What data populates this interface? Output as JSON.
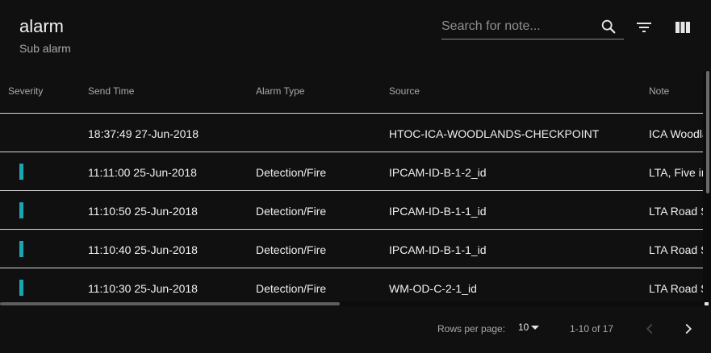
{
  "header": {
    "title": "alarm",
    "subtitle": "Sub alarm",
    "search_placeholder": "Search for note..."
  },
  "icons": {
    "search": "search-icon",
    "filter": "filter-list-icon",
    "columns": "view-column-icon",
    "dropdown": "caret-down-icon",
    "prev": "chevron-left-icon",
    "next": "chevron-right-icon"
  },
  "colors": {
    "severity_indicator": "#1aa5b3",
    "background": "#101010"
  },
  "table": {
    "columns": [
      "Severity",
      "Send Time",
      "Alarm Type",
      "Source",
      "Note"
    ],
    "rows": [
      {
        "severity": "",
        "send_time": "18:37:49 27-Jun-2018",
        "alarm_type": "",
        "source": "HTOC-ICA-WOODLANDS-CHECKPOINT",
        "note": "ICA Woodla"
      },
      {
        "severity": "teal",
        "send_time": "11:11:00 25-Jun-2018",
        "alarm_type": "Detection/Fire",
        "source": "IPCAM-ID-B-1-2_id",
        "note": "LTA, Five in"
      },
      {
        "severity": "teal",
        "send_time": "11:10:50 25-Jun-2018",
        "alarm_type": "Detection/Fire",
        "source": "IPCAM-ID-B-1-1_id",
        "note": "LTA Road S"
      },
      {
        "severity": "teal",
        "send_time": "11:10:40 25-Jun-2018",
        "alarm_type": "Detection/Fire",
        "source": "IPCAM-ID-B-1-1_id",
        "note": "LTA Road S"
      },
      {
        "severity": "teal",
        "send_time": "11:10:30 25-Jun-2018",
        "alarm_type": "Detection/Fire",
        "source": "WM-OD-C-2-1_id",
        "note": "LTA Road S"
      }
    ]
  },
  "pagination": {
    "rows_per_page_label": "Rows per page:",
    "rows_per_page_value": "10",
    "range": "1-10 of 17"
  }
}
